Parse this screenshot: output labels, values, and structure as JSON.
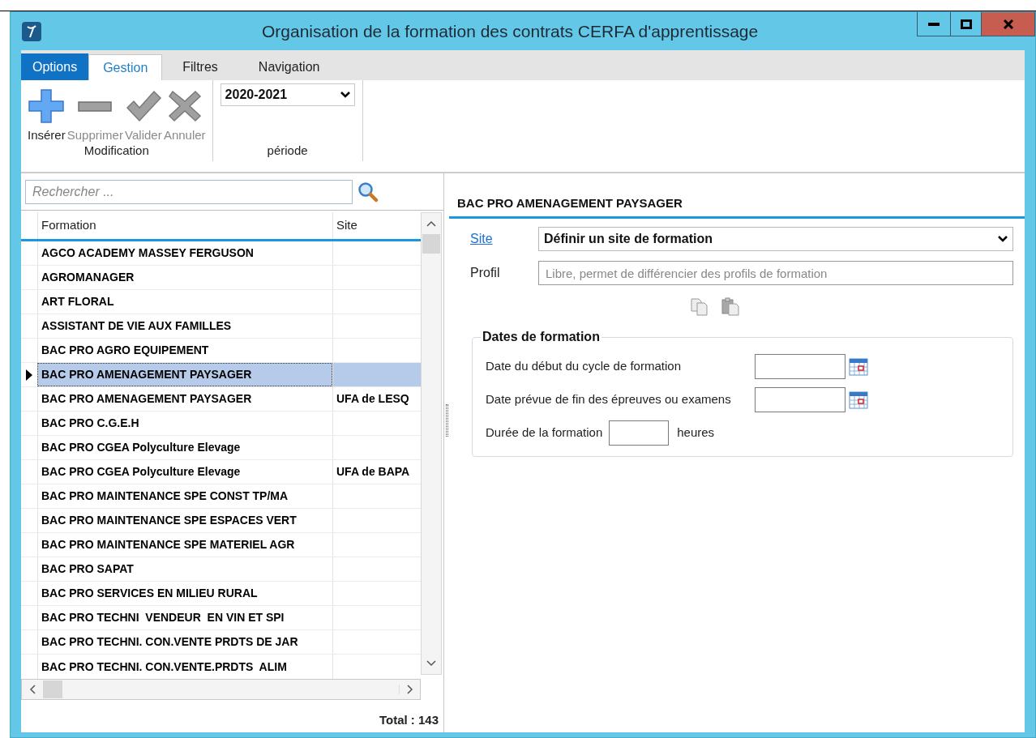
{
  "window": {
    "title": "Organisation de la formation des contrats CERFA d'apprentissage"
  },
  "tabs": [
    {
      "label": "Options",
      "kind": "file",
      "selected": false
    },
    {
      "label": "Gestion",
      "kind": "tab",
      "selected": true
    },
    {
      "label": "Filtres",
      "kind": "tab",
      "selected": false
    },
    {
      "label": "Navigation",
      "kind": "tab",
      "selected": false
    }
  ],
  "ribbon": {
    "groups": [
      {
        "label": "Modification",
        "buttons": [
          {
            "label": "Insérer",
            "disabled": false
          },
          {
            "label": "Supprimer",
            "disabled": true
          },
          {
            "label": "Valider",
            "disabled": true
          },
          {
            "label": "Annuler",
            "disabled": true
          }
        ]
      },
      {
        "label": "période",
        "select": "2020-2021"
      }
    ]
  },
  "list": {
    "search": {
      "placeholder": "Rechercher ..."
    },
    "columns": [
      "Formation",
      "Site"
    ],
    "rows": [
      {
        "formation": "AGCO ACADEMY MASSEY FERGUSON",
        "selected": false
      },
      {
        "formation": "AGROMANAGER",
        "selected": false
      },
      {
        "formation": "ART FLORAL",
        "selected": false
      },
      {
        "formation": "ASSISTANT DE VIE AUX FAMILLES",
        "selected": false
      },
      {
        "formation": "BAC PRO AGRO EQUIPEMENT",
        "selected": false
      },
      {
        "formation": "BAC PRO AMENAGEMENT PAYSAGER",
        "selected": true
      },
      {
        "formation": "BAC PRO AMENAGEMENT PAYSAGER",
        "site": "UFA de LESQ",
        "selected": false
      },
      {
        "formation": "BAC PRO C.G.E.H",
        "selected": false
      },
      {
        "formation": "BAC PRO CGEA Polyculture Elevage",
        "selected": false
      },
      {
        "formation": "BAC PRO CGEA Polyculture Elevage",
        "site": "UFA de BAPA",
        "selected": false
      },
      {
        "formation": "BAC PRO MAINTENANCE SPE CONST TP/MA",
        "selected": false
      },
      {
        "formation": "BAC PRO MAINTENANCE SPE ESPACES VERT",
        "selected": false
      },
      {
        "formation": "BAC PRO MAINTENANCE SPE MATERIEL AGR",
        "selected": false
      },
      {
        "formation": "BAC PRO SAPAT",
        "selected": false
      },
      {
        "formation": "BAC PRO SERVICES EN MILIEU RURAL",
        "selected": false
      },
      {
        "formation": "BAC PRO TECHNI  VENDEUR  EN VIN ET SPI",
        "selected": false
      },
      {
        "formation": "BAC PRO TECHNI. CON.VENTE PRDTS DE JAR",
        "selected": false
      },
      {
        "formation": "BAC PRO TECHNI. CON.VENTE.PRDTS  ALIM",
        "selected": false
      }
    ],
    "total": "Total : 143"
  },
  "detail": {
    "title": "BAC PRO AMENAGEMENT PAYSAGER",
    "site": {
      "label": "Site",
      "value": "Définir un site de formation"
    },
    "profil": {
      "label": "Profil",
      "placeholder": "Libre, permet de différencier des profils de formation"
    },
    "dates": {
      "legend": "Dates de formation",
      "fields": [
        {
          "label": "Date du début du cycle de formation",
          "kind": "date"
        },
        {
          "label": "Date prévue de fin des épreuves ou examens",
          "kind": "date"
        },
        {
          "label": "Durée de la formation",
          "kind": "hours",
          "unit": "heures"
        }
      ]
    }
  }
}
